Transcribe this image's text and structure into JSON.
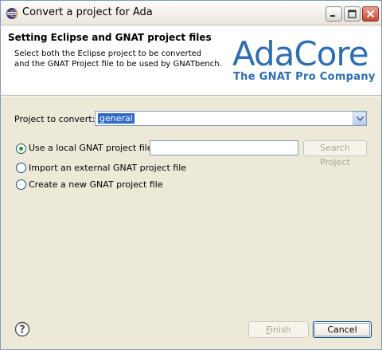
{
  "window": {
    "title": "Convert a project for Ada"
  },
  "banner": {
    "title": "Setting Eclipse and GNAT project files",
    "description_line1": "Select both the Eclipse project to be converted",
    "description_line2": "and the GNAT Project file to be used by GNATbench.",
    "logo_text": "AdaCore",
    "logo_tagline": "The GNAT Pro Company",
    "brand_color": "#2e6eb1"
  },
  "form": {
    "project_label": "Project to convert:",
    "project_value": "general",
    "options": [
      {
        "label": "Use a local GNAT project file:",
        "selected": true
      },
      {
        "label": "Import an external GNAT project file",
        "selected": false
      },
      {
        "label": "Create a new GNAT project file",
        "selected": false
      }
    ],
    "local_file_value": "",
    "search_button": "Search Project"
  },
  "footer": {
    "finish_label_first": "F",
    "finish_label_rest": "inish",
    "cancel_label": "Cancel"
  }
}
